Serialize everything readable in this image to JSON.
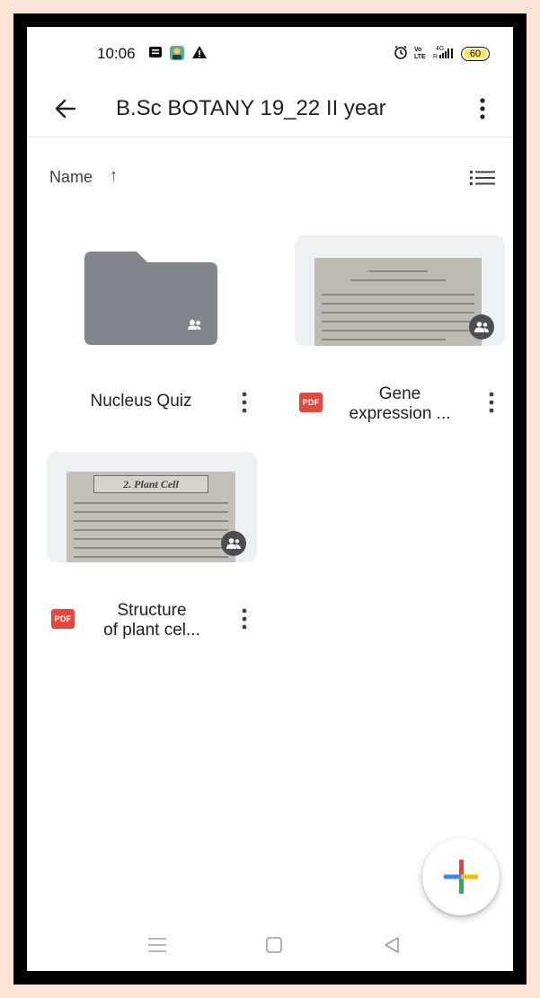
{
  "status_bar": {
    "time": "10:06",
    "battery": "60",
    "network": "4G"
  },
  "app_bar": {
    "title": "B.Sc BOTANY 19_22 II year"
  },
  "sort": {
    "label": "Name",
    "direction_arrow": "↑"
  },
  "items": [
    {
      "type": "folder",
      "name": "Nucleus Quiz",
      "shared": true
    },
    {
      "type": "pdf",
      "name_line1": "Gene",
      "name_line2": "expression ...",
      "badge": "PDF",
      "shared": true
    },
    {
      "type": "pdf",
      "name_line1": "Structure",
      "name_line2": "of plant cel...",
      "badge": "PDF",
      "shared": true,
      "thumb_heading": "2. Plant Cell"
    }
  ],
  "colors": {
    "folder": "#80868b",
    "pdf_badge": "#e2493c",
    "fab_blue": "#4285f4",
    "fab_red": "#ea4335",
    "fab_yellow": "#fbbc04",
    "fab_green": "#34a853"
  }
}
